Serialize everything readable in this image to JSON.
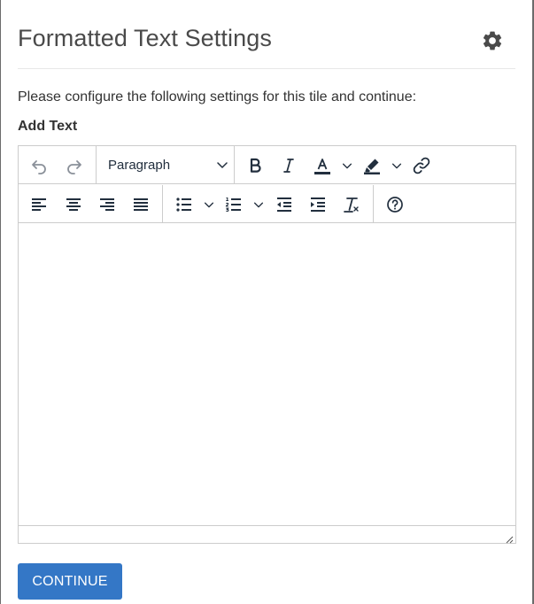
{
  "header": {
    "title": "Formatted Text Settings",
    "settings_icon": "gear-icon"
  },
  "form": {
    "intro": "Please configure the following settings for this tile and continue:",
    "field_label": "Add Text"
  },
  "editor": {
    "block_format": "Paragraph",
    "content": "",
    "toolbar_row1": [
      "undo-icon",
      "redo-icon",
      "block-format-select",
      "bold-icon",
      "italic-icon",
      "text-color-icon",
      "highlight-color-icon",
      "link-icon"
    ],
    "toolbar_row2": [
      "align-left-icon",
      "align-center-icon",
      "align-right-icon",
      "align-justify-icon",
      "bullet-list-icon",
      "numbered-list-icon",
      "outdent-icon",
      "indent-icon",
      "clear-formatting-icon",
      "help-icon"
    ]
  },
  "actions": {
    "continue_label": "CONTINUE"
  },
  "colors": {
    "primary_button": "#3477c6",
    "title_text": "#4a4a4a",
    "icon": "#222f3e",
    "icon_disabled": "#8a9099",
    "border": "#cccccc"
  }
}
